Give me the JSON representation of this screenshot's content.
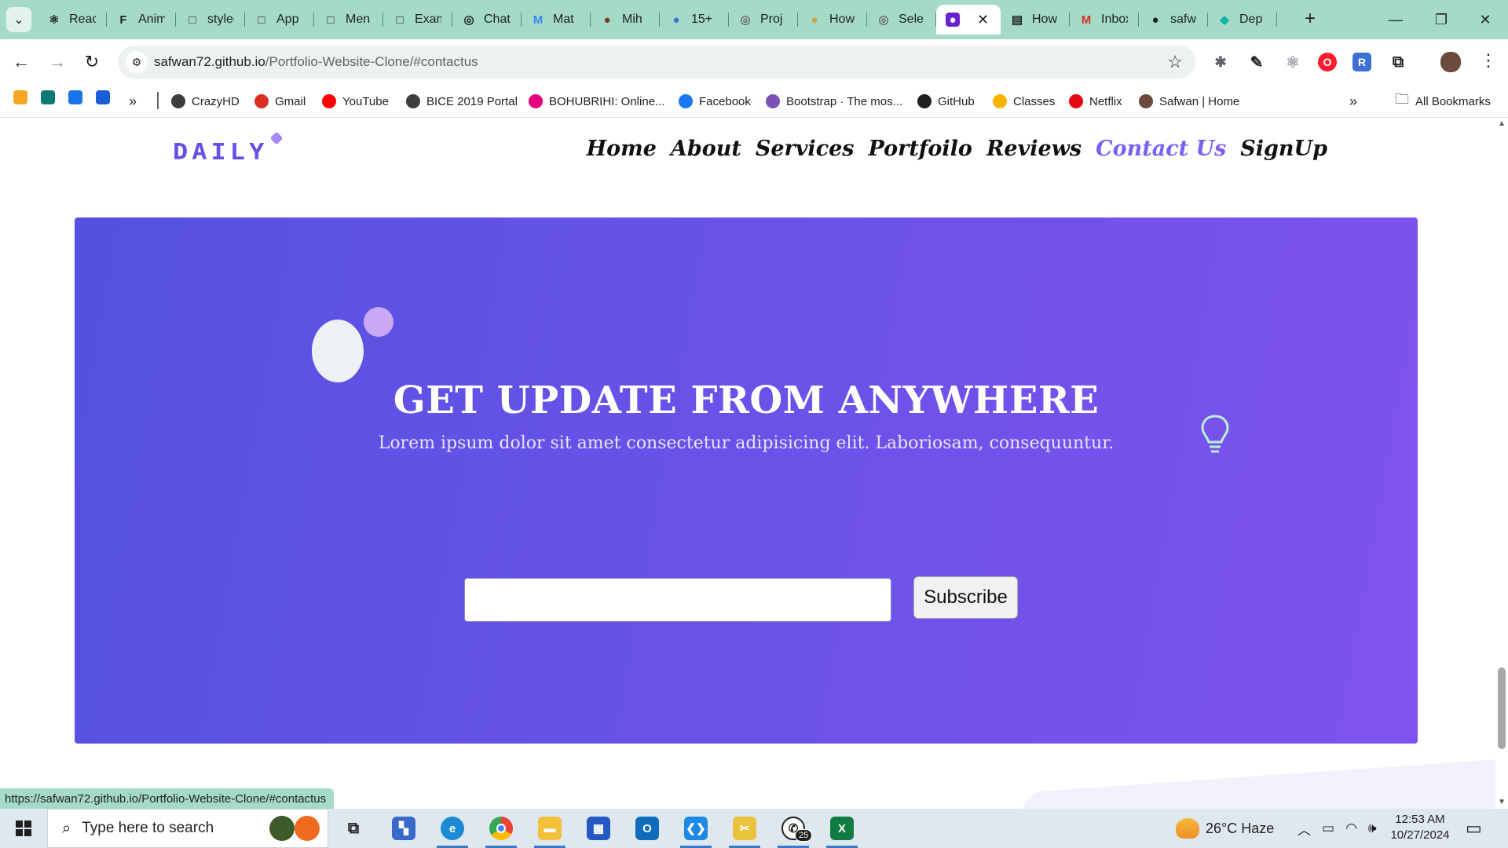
{
  "browser": {
    "tabs": [
      {
        "title": "React",
        "color": "#1f1f1f",
        "glyph": "⚛"
      },
      {
        "title": "Anima",
        "color": "#1f1f1f",
        "glyph": "F"
      },
      {
        "title": "styled",
        "color": "#1f1f1f",
        "glyph": "□"
      },
      {
        "title": "App",
        "color": "#1f1f1f",
        "glyph": "□"
      },
      {
        "title": "Men",
        "color": "#1f1f1f",
        "glyph": "□"
      },
      {
        "title": "Exam",
        "color": "#1f1f1f",
        "glyph": "□"
      },
      {
        "title": "Chat",
        "color": "#1f1f1f",
        "glyph": "◎"
      },
      {
        "title": "Mat",
        "color": "#3b82f6",
        "glyph": "M"
      },
      {
        "title": "Mih",
        "color": "#7a3b2e",
        "glyph": "●"
      },
      {
        "title": "15+",
        "color": "#3b6fd6",
        "glyph": "●"
      },
      {
        "title": "Proj",
        "color": "#6b6b6b",
        "glyph": "◎"
      },
      {
        "title": "How",
        "color": "#c9a24a",
        "glyph": "●"
      },
      {
        "title": "Sele",
        "color": "#6b6b6b",
        "glyph": "◎"
      },
      {
        "title": "",
        "color": "#6a1fd0",
        "glyph": "●",
        "active": true
      },
      {
        "title": "How",
        "color": "#1f1f1f",
        "glyph": "▤"
      },
      {
        "title": "Inbox",
        "color": "#d93025",
        "glyph": "M"
      },
      {
        "title": "safw",
        "color": "#1f1f1f",
        "glyph": "●"
      },
      {
        "title": "Dep",
        "color": "#13b3a8",
        "glyph": "◆"
      }
    ],
    "url_host": "safwan72.github.io",
    "url_path": "/Portfolio-Website-Clone/#contactus",
    "bookmarks": [
      {
        "label": "CrazyHD",
        "color": "#3c3c3c"
      },
      {
        "label": "Gmail",
        "color": "#d93025"
      },
      {
        "label": "YouTube",
        "color": "#ff0000"
      },
      {
        "label": "BICE 2019 Portal",
        "color": "#3c3c3c"
      },
      {
        "label": "BOHUBRIHI: Online...",
        "color": "#e6007e"
      },
      {
        "label": "Facebook",
        "color": "#1877f2"
      },
      {
        "label": "Bootstrap · The mos...",
        "color": "#7952b3"
      },
      {
        "label": "GitHub",
        "color": "#1f1f1f"
      },
      {
        "label": "Classes",
        "color": "#f4b400"
      },
      {
        "label": "Netflix",
        "color": "#e50914"
      },
      {
        "label": "Safwan | Home",
        "color": "#6b4b3b"
      }
    ],
    "all_bookmarks_label": "All Bookmarks",
    "status_url": "https://safwan72.github.io/Portfolio-Website-Clone/#contactus"
  },
  "page": {
    "logo": "DAILY",
    "nav": [
      {
        "label": "Home",
        "active": false
      },
      {
        "label": "About",
        "active": false
      },
      {
        "label": "Services",
        "active": false
      },
      {
        "label": "Portfoilo",
        "active": false
      },
      {
        "label": "Reviews",
        "active": false
      },
      {
        "label": "Contact Us",
        "active": true
      },
      {
        "label": "SignUp",
        "active": false
      }
    ],
    "banner": {
      "title": "GET UPDATE FROM ANYWHERE",
      "subtitle": "Lorem ipsum dolor sit amet consectetur adipisicing elit. Laboriosam, consequuntur.",
      "email_value": "",
      "subscribe_label": "Subscribe"
    }
  },
  "taskbar": {
    "search_placeholder": "Type here to search",
    "weather": "26°C  Haze",
    "time": "12:53 AM",
    "date": "10/27/2024",
    "whatsapp_badge": "25"
  },
  "colors": {
    "chrome_accent": "#a5dbc6",
    "brand": "#6a4fe6",
    "nav_active": "#7b5ff0"
  }
}
